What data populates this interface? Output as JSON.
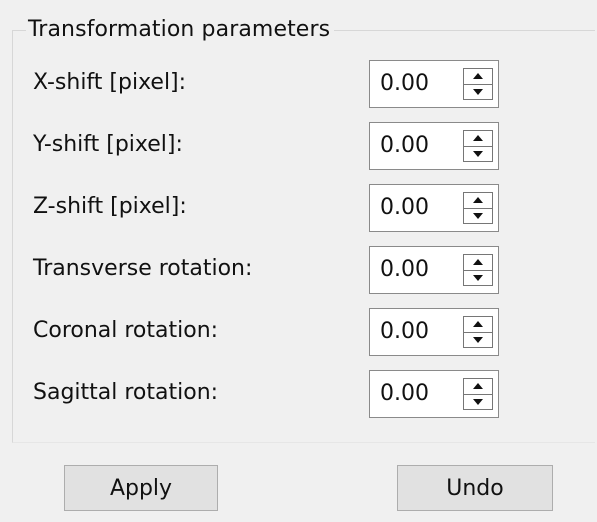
{
  "group": {
    "title": "Transformation parameters"
  },
  "parameters": [
    {
      "label": "X-shift [pixel]:",
      "value": "0.00"
    },
    {
      "label": "Y-shift [pixel]:",
      "value": "0.00"
    },
    {
      "label": "Z-shift [pixel]:",
      "value": "0.00"
    },
    {
      "label": "Transverse rotation:",
      "value": "0.00"
    },
    {
      "label": "Coronal rotation:",
      "value": "0.00"
    },
    {
      "label": "Sagittal rotation:",
      "value": "0.00"
    }
  ],
  "actions": {
    "apply_label": "Apply",
    "undo_label": "Undo"
  },
  "icons": {
    "spin_up": "arrow-up-icon",
    "spin_down": "arrow-down-icon"
  },
  "colors": {
    "window_background": "#f0f0f0",
    "field_background": "#ffffff",
    "button_background": "#e1e1e1",
    "border": "#adadad"
  }
}
